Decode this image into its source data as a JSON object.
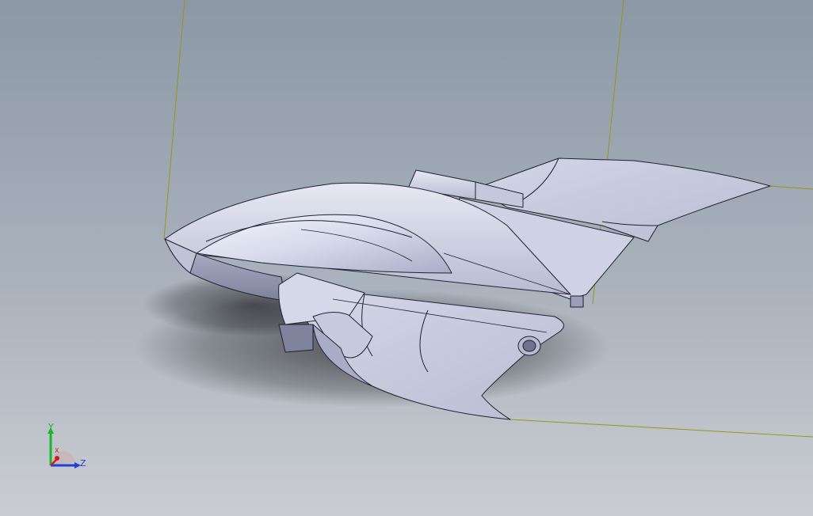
{
  "viewport": {
    "background_top": "#8d99a7",
    "background_bottom": "#c9ccd1",
    "sketch_line_color": "#8f9a1a",
    "body_color": "#c9cde2",
    "edge_color": "#1f2230"
  },
  "triad": {
    "y_label": "Y",
    "z_label": "Z",
    "x_label": "X",
    "y_color": "#17b82d",
    "z_color": "#1e3fd8",
    "x_color": "#d11b1b"
  }
}
